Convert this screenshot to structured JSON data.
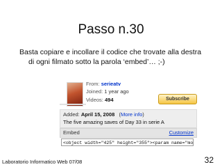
{
  "slide": {
    "title": "Passo n.30",
    "bullet_line1": "Basta copiare e incollare il codice che trovate alla destra",
    "bullet_line2": "di ogni filmato sotto la parola ‘embed’…  ;-)",
    "footer": "Laboratorio Informatico Web 07/08",
    "page_number": "32"
  },
  "channel": {
    "from_label": "From:",
    "from_user": "serieatv",
    "joined_label": "Joined:",
    "joined_value": "1 year ago",
    "videos_label": "Videos:",
    "videos_value": "494",
    "subscribe_label": "Subscribe"
  },
  "video": {
    "added_label": "Added:",
    "added_date": "April 15, 2008",
    "more_info": "More info",
    "description": "The five amazing saves of Day 33 in serie A"
  },
  "embed": {
    "label": "Embed",
    "customize_label": "Customize",
    "code_value": "<object width=\"425\" height=\"355\"><param name=\"movie\" value=\"h"
  },
  "colors": {
    "link": "#0033cc",
    "subscribe_bg": "#f5c542",
    "panel_bg": "#eeeeee"
  }
}
